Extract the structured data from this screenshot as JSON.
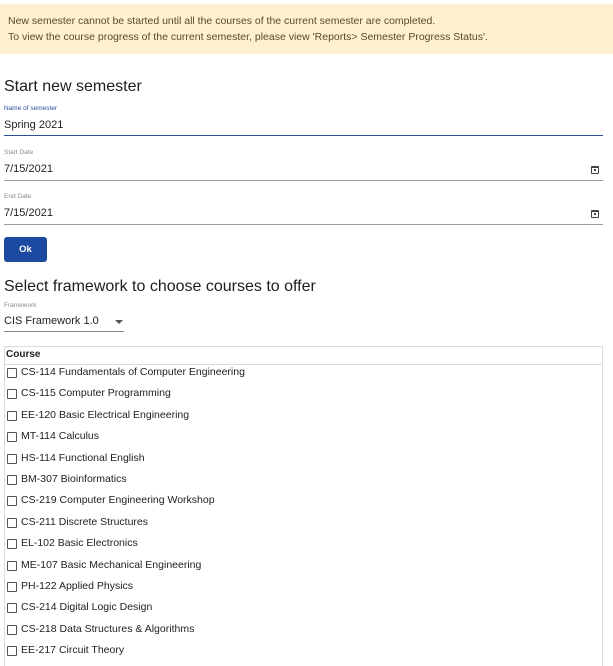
{
  "banner": {
    "line1": "New semester cannot be started until all the courses of the current semester are completed.",
    "line2": "To view the course progress of the current semester, please view 'Reports> Semester Progress Status'."
  },
  "colors": {
    "banner_bg": "#fdf1d2",
    "accent": "#1c4aa0",
    "active_label": "#2f4ea0"
  },
  "new_semester": {
    "heading": "Start new semester",
    "name_label": "Name of semester",
    "name_value": "Spring 2021",
    "start_label": "Start Date",
    "start_value": "7/15/2021",
    "end_label": "End Date",
    "end_value": "7/15/2021",
    "ok_label": "Ok"
  },
  "framework": {
    "heading": "Select framework to choose courses to offer",
    "label": "Framework",
    "selected": "CIS Framework 1.0"
  },
  "courses": {
    "header": "Course",
    "items": [
      "CS-114 Fundamentals of Computer Engineering",
      "CS-115 Computer Programming",
      "EE-120 Basic Electrical Engineering",
      "MT-114 Calculus",
      "HS-114 Functional English",
      "BM-307 Bioinformatics",
      "CS-219 Computer Engineering Workshop",
      "CS-211 Discrete Structures",
      "EL-102 Basic Electronics",
      "ME-107 Basic Mechanical Engineering",
      "PH-122 Applied Physics",
      "CS-214 Digital Logic Design",
      "CS-218 Data Structures & Algorithms",
      "EE-217 Circuit Theory"
    ]
  }
}
